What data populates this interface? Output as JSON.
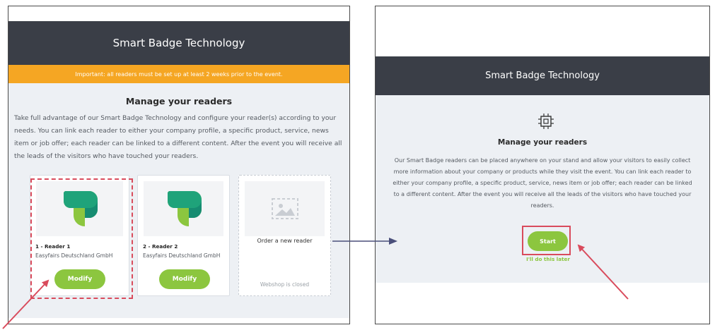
{
  "left_panel": {
    "header_title": "Smart Badge Technology",
    "notice": "Important: all readers must be set up at least 2 weeks prior to the event.",
    "section_title": "Manage your readers",
    "description": "Take full advantage of our Smart Badge Technology and configure your reader(s) according to your needs. You can link each reader to either your company profile, a specific product, service, news item or job offer; each reader can be linked to a different content. After the event you will receive all the leads of the visitors who have touched your readers.",
    "readers": [
      {
        "name": "1 - Reader 1",
        "company": "Easyfairs Deutschland GmbH",
        "button_label": "Modify"
      },
      {
        "name": "2 - Reader 2",
        "company": "Easyfairs Deutschland GmbH",
        "button_label": "Modify"
      }
    ],
    "order_card": {
      "label": "Order a new reader",
      "status": "Webshop is closed"
    }
  },
  "right_panel": {
    "header_title": "Smart Badge Technology",
    "icon": "chip-icon",
    "section_title": "Manage your readers",
    "description": "Our Smart Badge readers can be placed anywhere on your stand and allow your visitors to easily collect more information about your company or products while they visit the event. You can link each reader to either your company profile, a specific product, service, news item or job offer; each reader can be linked to a different content. After the event you will receive all the leads of the visitors who have touched your readers.",
    "start_label": "Start",
    "later_label": "I'll do this later"
  },
  "colors": {
    "header": "#3a3e47",
    "notice": "#f5a623",
    "accent_green": "#8cc63f",
    "annotation_red": "#d94b5c",
    "connector_arrow": "#4a4f7a",
    "background_gray": "#edf0f4"
  }
}
